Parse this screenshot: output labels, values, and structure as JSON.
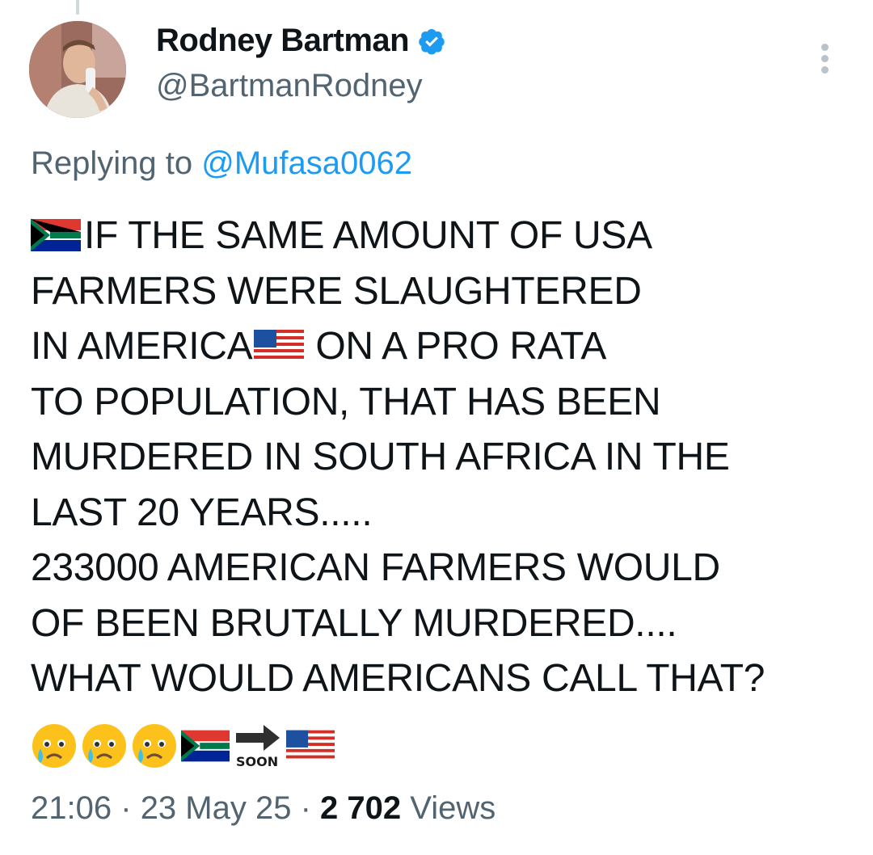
{
  "author": {
    "name": "Rodney Bartman",
    "handle": "@BartmanRodney",
    "verified": true
  },
  "reply": {
    "prefix": "Replying to",
    "to_handle": "@Mufasa0062"
  },
  "tweet": {
    "lines": [
      "IF THE SAME AMOUNT OF USA",
      "FARMERS WERE SLAUGHTERED",
      "IN AMERICA",
      "ON A PRO RATA",
      "TO POPULATION, THAT HAS BEEN",
      "MURDERED IN SOUTH AFRICA IN THE",
      "LAST 20 YEARS.....",
      "233000 AMERICAN FARMERS WOULD",
      "OF BEEN BRUTALLY MURDERED....",
      "WHAT WOULD AMERICANS CALL THAT?"
    ],
    "soon_label": "SOON",
    "emojis": [
      "crying-face-icon",
      "crying-face-icon",
      "crying-face-icon",
      "south-africa-flag-icon",
      "soon-arrow-icon",
      "usa-flag-icon"
    ]
  },
  "meta": {
    "time": "21:06",
    "date": "23 May 25",
    "views_count": "2 702",
    "views_label": "Views",
    "separator": "·"
  },
  "colors": {
    "text": "#0f1419",
    "secondary": "#536471",
    "link": "#1d9bf0",
    "verified": "#1d9bf0"
  }
}
